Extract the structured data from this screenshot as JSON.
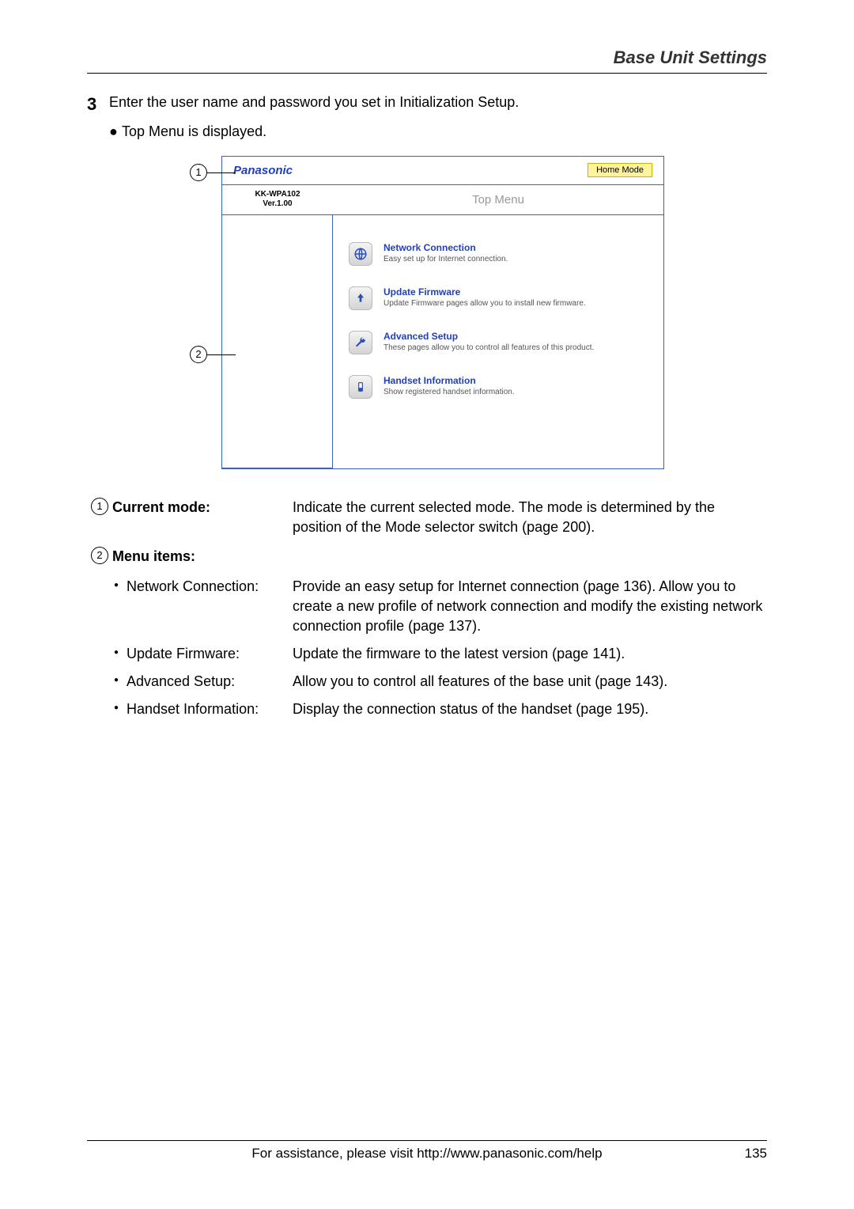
{
  "header_title": "Base Unit Settings",
  "step_number": "3",
  "step_text": "Enter the user name and password you set in Initialization Setup.",
  "step_bullet": "Top Menu is displayed.",
  "callout1": "1",
  "callout2": "2",
  "screenshot": {
    "brand": "Panasonic",
    "mode_badge": "Home Mode",
    "model_line1": "KK-WPA102",
    "model_line2": "Ver.1.00",
    "top_menu": "Top Menu",
    "items": [
      {
        "title": "Network Connection",
        "desc": "Easy set up for Internet connection."
      },
      {
        "title": "Update Firmware",
        "desc": "Update Firmware pages allow you to install new firmware."
      },
      {
        "title": "Advanced Setup",
        "desc": "These pages allow you to control all features of this product."
      },
      {
        "title": "Handset Information",
        "desc": "Show registered handset information."
      }
    ]
  },
  "defs": {
    "num1": "1",
    "num2": "2",
    "label1": "Current mode:",
    "desc1": "Indicate the current selected mode. The mode is determined by the position of the Mode selector switch (page 200).",
    "label2": "Menu items:",
    "subs": [
      {
        "label": "Network Connection:",
        "desc": "Provide an easy setup for Internet connection (page 136). Allow you to create a new profile of network connection and modify the existing network connection profile (page 137)."
      },
      {
        "label": "Update Firmware:",
        "desc": "Update the firmware to the latest version (page 141)."
      },
      {
        "label": "Advanced Setup:",
        "desc": "Allow you to control all features of the base unit (page 143)."
      },
      {
        "label": "Handset Information:",
        "desc": "Display the connection status of the handset (page 195)."
      }
    ]
  },
  "footer_text": "For assistance, please visit http://www.panasonic.com/help",
  "page_number": "135"
}
